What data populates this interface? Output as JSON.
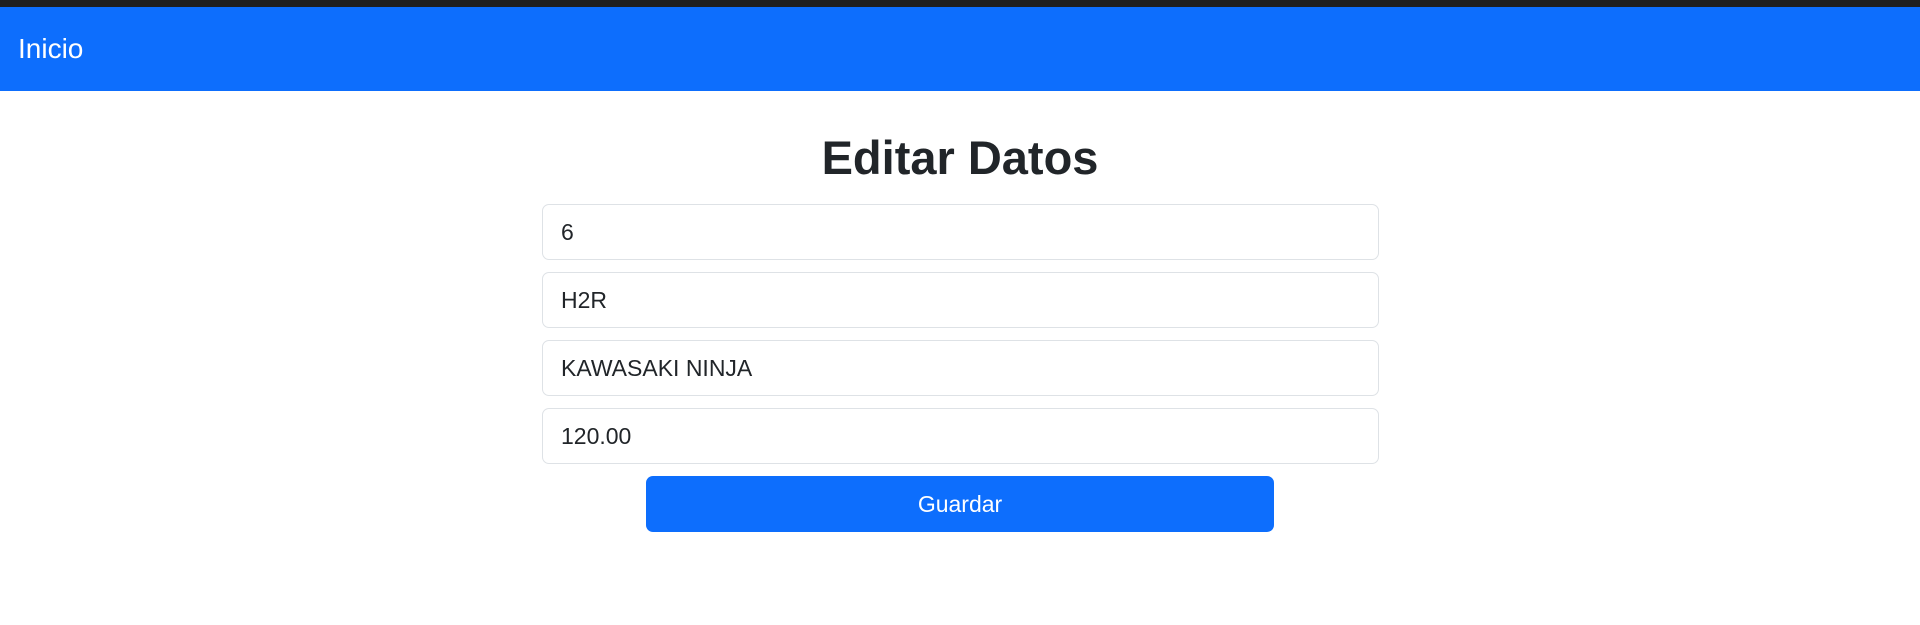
{
  "navbar": {
    "brand": "Inicio"
  },
  "page": {
    "title": "Editar Datos"
  },
  "form": {
    "fields": [
      {
        "value": "6"
      },
      {
        "value": "H2R"
      },
      {
        "value": "KAWASAKI NINJA"
      },
      {
        "value": "120.00"
      }
    ],
    "save_label": "Guardar"
  },
  "colors": {
    "primary": "#0d6efd",
    "text": "#212529",
    "border": "#dee2e6"
  }
}
